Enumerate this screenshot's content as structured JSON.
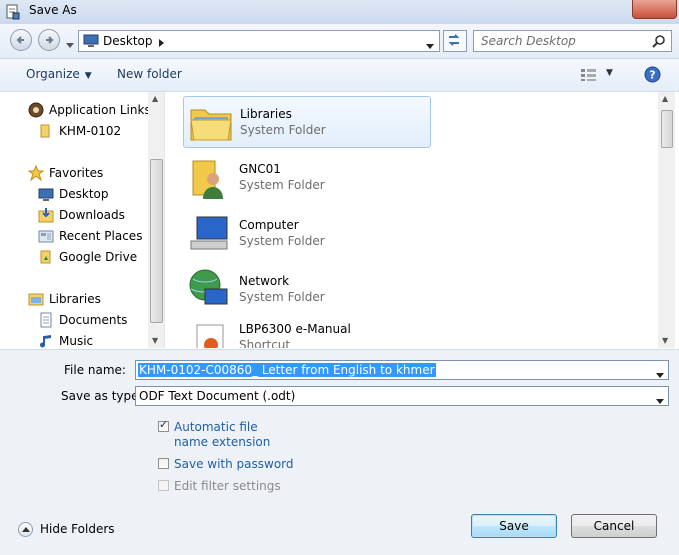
{
  "window": {
    "title": "Save As",
    "title_icon": "save-as-document-icon"
  },
  "navbar": {
    "address": {
      "icon": "desktop-icon",
      "path": "Desktop"
    },
    "search": {
      "placeholder": "Search Desktop"
    }
  },
  "toolbar": {
    "organize_label": "Organize",
    "new_folder_label": "New folder"
  },
  "nav_pane": {
    "items": [
      {
        "label": "Application Links",
        "icon": "application-links-icon"
      },
      {
        "label": "KHM-0102",
        "icon": "folder-icon"
      },
      {
        "label": "Favorites",
        "icon": "favorites-star-icon"
      },
      {
        "label": "Desktop",
        "icon": "desktop-icon"
      },
      {
        "label": "Downloads",
        "icon": "downloads-icon"
      },
      {
        "label": "Recent Places",
        "icon": "recent-places-icon"
      },
      {
        "label": "Google Drive",
        "icon": "google-drive-icon"
      },
      {
        "label": "Libraries",
        "icon": "libraries-icon"
      },
      {
        "label": "Documents",
        "icon": "documents-icon"
      },
      {
        "label": "Music",
        "icon": "music-icon"
      }
    ]
  },
  "content": {
    "items": [
      {
        "name": "Libraries",
        "type": "System Folder",
        "icon": "libraries-folder-icon",
        "selected": true
      },
      {
        "name": "GNC01",
        "type": "System Folder",
        "icon": "user-folder-icon",
        "selected": false
      },
      {
        "name": "Computer",
        "type": "System Folder",
        "icon": "computer-icon",
        "selected": false
      },
      {
        "name": "Network",
        "type": "System Folder",
        "icon": "network-icon",
        "selected": false
      },
      {
        "name": "LBP6300 e-Manual",
        "type": "Shortcut",
        "icon": "shortcut-icon",
        "selected": false
      }
    ]
  },
  "form": {
    "file_name_label": "File name:",
    "file_name_value": "KHM-0102-C00860_ Letter from English to khmer",
    "save_as_type_label": "Save as type:",
    "save_as_type_value": "ODF Text Document (.odt)",
    "options": [
      {
        "label": "Automatic file name extension",
        "checked": true,
        "enabled": true
      },
      {
        "label": "Save with password",
        "checked": false,
        "enabled": true
      },
      {
        "label": "Edit filter settings",
        "checked": false,
        "enabled": false
      }
    ]
  },
  "footer": {
    "hide_folders_label": "Hide Folders",
    "save_label": "Save",
    "cancel_label": "Cancel"
  },
  "colors": {
    "selection": "#3399ff",
    "link_text": "#1e5fa6",
    "toolbar_text": "#1e395b"
  }
}
